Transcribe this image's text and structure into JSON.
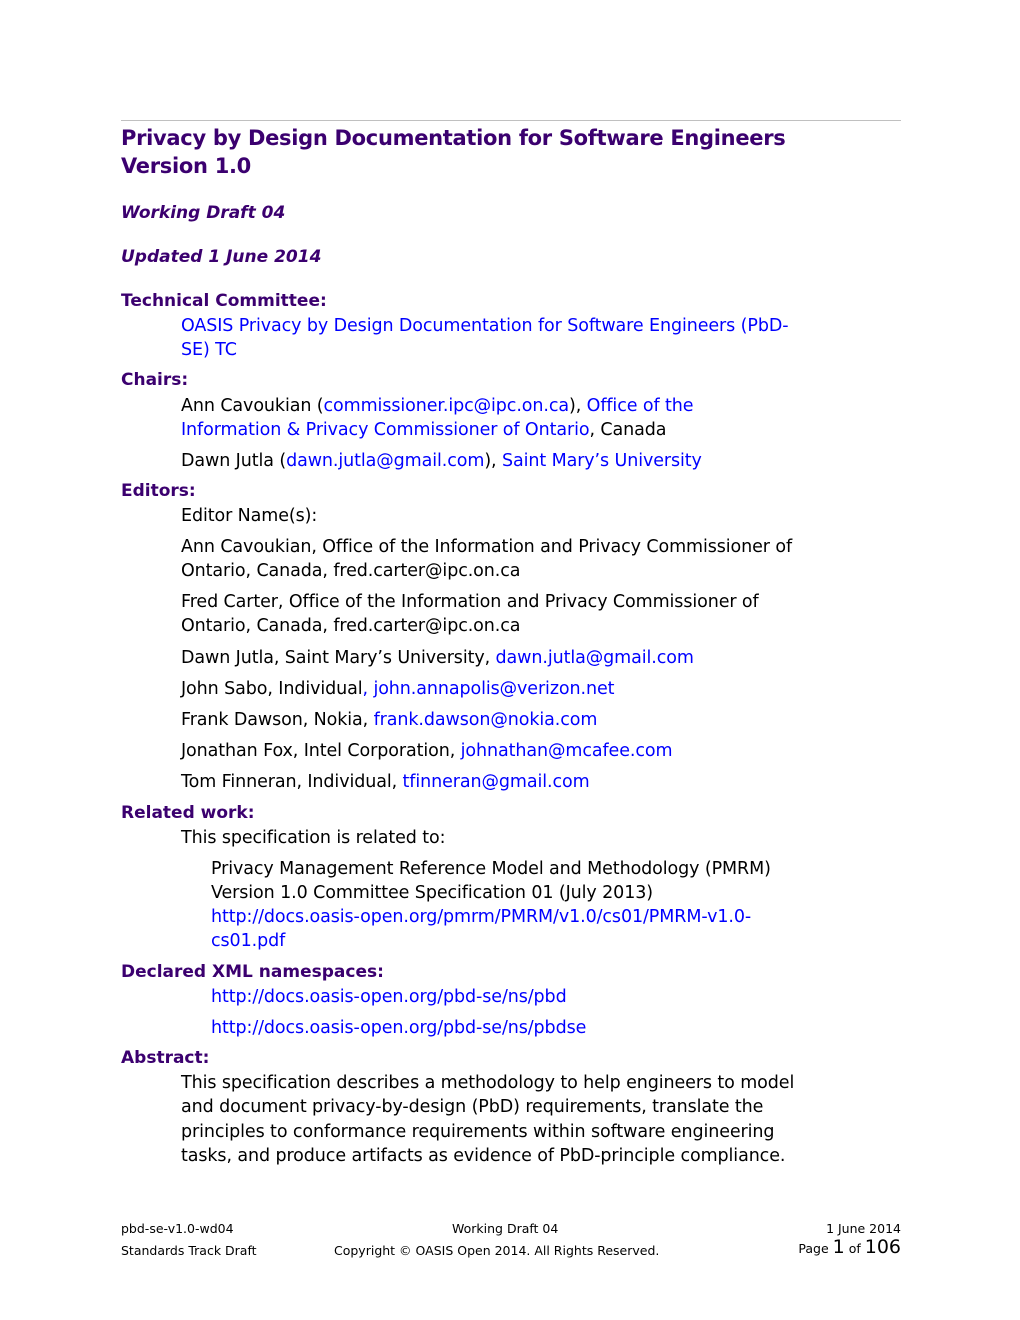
{
  "document": {
    "title_line1": "Privacy by Design Documentation for Software Engineers",
    "title_line2": "Version 1.0",
    "stage": "Working Draft 04",
    "updated": "Updated 1 June 2014"
  },
  "colors": {
    "heading": "#3b006f",
    "link": "#0000ff",
    "rule": "#c0c0c0"
  },
  "technical_committee": {
    "label": "Technical Committee:",
    "link_line1": "OASIS Privacy by Design Documentation for Software Engineers (PbD-",
    "link_line2": "SE) TC"
  },
  "chairs": {
    "label": "Chairs:",
    "items": [
      {
        "name": "Ann Cavoukian (",
        "email": "commissioner.ipc@ipc.on.ca",
        "sep": "), ",
        "org_line1": "Office of the",
        "org_line2": "Information & Privacy Commissioner of Ontario",
        "suffix": ", Canada"
      },
      {
        "name": "Dawn Jutla (",
        "email": "dawn.jutla@gmail.com",
        "sep": "), ",
        "org": "Saint Mary’s University"
      }
    ]
  },
  "editors": {
    "label": "Editors:",
    "intro": "Editor Name(s):",
    "items": [
      {
        "line1": "Ann Cavoukian, Office of the Information and Privacy Commissioner of",
        "line2": "Ontario, Canada, fred.carter@ipc.on.ca"
      },
      {
        "line1": "Fred Carter, Office of the Information and Privacy Commissioner of",
        "line2": "Ontario, Canada, fred.carter@ipc.on.ca"
      },
      {
        "text": "Dawn Jutla, Saint Mary’s University, ",
        "email": "dawn.jutla@gmail.com"
      },
      {
        "text": "John Sabo, Individual",
        "email": ", john.annapolis@verizon.net"
      },
      {
        "text": "Frank Dawson, Nokia, ",
        "email": "frank.dawson@nokia.com"
      },
      {
        "text": "Jonathan Fox, Intel Corporation, ",
        "email": "johnathan@mcafee.com"
      },
      {
        "text": "Tom Finneran, Individual, ",
        "email": "tfinneran@gmail.com"
      }
    ]
  },
  "related_work": {
    "label": "Related work:",
    "intro": "This specification is related to:",
    "item_line1": "Privacy Management Reference Model and Methodology (PMRM)",
    "item_line2": "Version 1.0 Committee Specification 01 (July 2013)",
    "url_line1": "http://docs.oasis-open.org/pmrm/PMRM/v1.0/cs01/PMRM-v1.0-",
    "url_line2": "cs01.pdf"
  },
  "namespaces": {
    "label": "Declared XML namespaces:",
    "items": [
      "http://docs.oasis-open.org/pbd-se/ns/pbd",
      "http://docs.oasis-open.org/pbd-se/ns/pbdse"
    ]
  },
  "abstract": {
    "label": "Abstract:",
    "lines": [
      "This specification describes a methodology to help engineers to model",
      "and document privacy-by-design (PbD) requirements, translate the",
      "principles to conformance requirements within software engineering",
      "tasks, and produce artifacts as evidence of PbD-principle compliance."
    ]
  },
  "footer": {
    "doc_id": "pbd-se-v1.0-wd04",
    "stage": "Working Draft 04",
    "date": "1 June 2014",
    "track": "Standards Track Draft",
    "copyright": "Copyright © OASIS Open 2014. All Rights Reserved.",
    "page_prefix": "Page ",
    "page_current": "1",
    "page_of": " of ",
    "page_total": "106"
  }
}
